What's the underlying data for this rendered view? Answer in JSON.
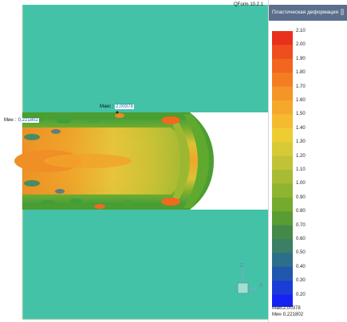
{
  "app": {
    "title": "QForm 10.2.1"
  },
  "viewport": {
    "max_label": "Макс : ",
    "max_value": "2,00378",
    "min_label": "Мин : ",
    "min_value": "0,221802",
    "axis_z": "Z",
    "axis_x": "X"
  },
  "legend": {
    "title": "Пластическая деформация",
    "pin_icon": "pin-icon",
    "ticks": [
      "2.10",
      "2.00",
      "1.90",
      "1.80",
      "1.70",
      "1.60",
      "1.50",
      "1.40",
      "1.30",
      "1.20",
      "1.10",
      "1.00",
      "0.90",
      "0.80",
      "0.70",
      "0.60",
      "0.50",
      "0.40",
      "0.30",
      "0.20"
    ],
    "colors": [
      "#e8301c",
      "#ee4e1d",
      "#f2661f",
      "#f47d22",
      "#f59528",
      "#f5a82b",
      "#f4bb2e",
      "#eecd33",
      "#d8c936",
      "#c2c236",
      "#a8bb34",
      "#8fb432",
      "#74ab2e",
      "#5a9c34",
      "#45894a",
      "#3b7f66",
      "#2c6f8a",
      "#2257b0",
      "#1a3dd8",
      "#1422f4"
    ],
    "max_label": "Макс :",
    "max_value": "2,00378",
    "min_label": "Мин :",
    "min_value": "0,221802"
  },
  "colors": {
    "tool": "#44c2a8",
    "billet_base": "#58a62e",
    "billet_core": "#e9b83d",
    "billet_hot": "#ef8f26",
    "panel_header": "#5b6f8c"
  }
}
